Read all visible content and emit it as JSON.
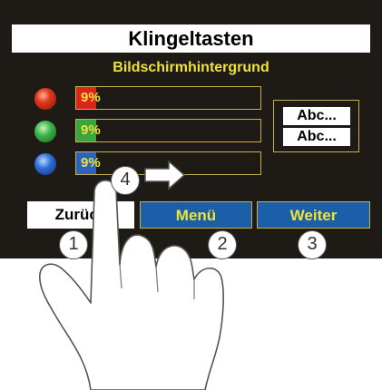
{
  "screen": {
    "title": "Klingeltasten",
    "subtitle": "Bildschirmhintergrund"
  },
  "color_rows": [
    {
      "led": "red-led",
      "value": "9%"
    },
    {
      "led": "green-led",
      "value": "9%"
    },
    {
      "led": "blue-led",
      "value": "9%"
    }
  ],
  "preview": {
    "line1": "Abc...",
    "line2": "Abc..."
  },
  "buttons": {
    "back": "Zurück",
    "menu": "Menü",
    "next": "Weiter"
  },
  "callouts": {
    "one": "1",
    "two": "2",
    "three": "3",
    "four": "4"
  },
  "colors": {
    "background": "#1e1b16",
    "accent_text": "#f0e23a",
    "button_blue": "#1b5fa8",
    "border": "#c9b04a"
  }
}
